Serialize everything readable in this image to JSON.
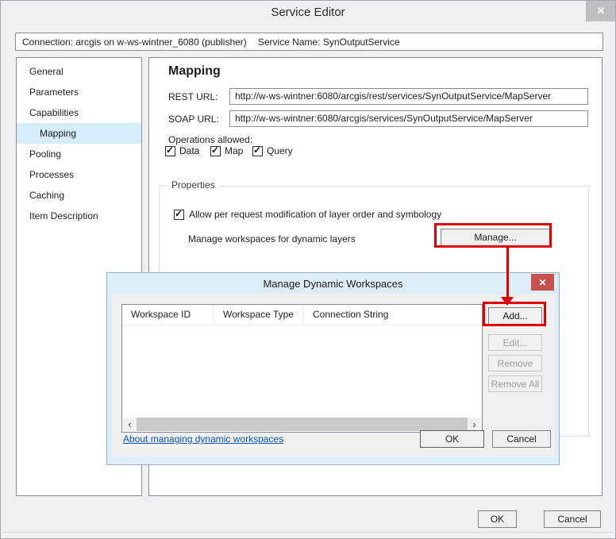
{
  "window": {
    "title": "Service Editor",
    "connection_text": "Connection: arcgis on w-ws-wintner_6080 (publisher)",
    "service_name_text": "Service Name: SynOutputService",
    "ok_label": "OK",
    "cancel_label": "Cancel"
  },
  "icons": {
    "close_x": "✕",
    "check": "✓",
    "scroll_left": "‹",
    "scroll_right": "›"
  },
  "sidebar": {
    "items": [
      {
        "label": "General",
        "selected": false
      },
      {
        "label": "Parameters",
        "selected": false
      },
      {
        "label": "Capabilities",
        "selected": false
      },
      {
        "label": "Mapping",
        "selected": true
      },
      {
        "label": "Pooling",
        "selected": false
      },
      {
        "label": "Processes",
        "selected": false
      },
      {
        "label": "Caching",
        "selected": false
      },
      {
        "label": "Item Description",
        "selected": false
      }
    ]
  },
  "main": {
    "heading": "Mapping",
    "rest_url": {
      "label": "REST URL:",
      "value": "http://w-ws-wintner:6080/arcgis/rest/services/SynOutputService/MapServer"
    },
    "soap_url": {
      "label": "SOAP URL:",
      "value": "http://w-ws-wintner:6080/arcgis/services/SynOutputService/MapServer"
    },
    "operations_label": "Operations allowed:",
    "operations": [
      {
        "label": "Data",
        "checked": true
      },
      {
        "label": "Map",
        "checked": true
      },
      {
        "label": "Query",
        "checked": true
      }
    ],
    "properties": {
      "legend": "Properties",
      "allow_checkbox_label": "Allow per request modification of layer order and symbology",
      "allow_checked": true,
      "manage_label": "Manage workspaces for dynamic layers",
      "manage_button": "Manage..."
    }
  },
  "dialog": {
    "title": "Manage Dynamic Workspaces",
    "table": {
      "columns": [
        "Workspace ID",
        "Workspace Type",
        "Connection String"
      ],
      "rows": []
    },
    "buttons": {
      "add": {
        "label": "Add...",
        "enabled": true,
        "highlighted": true
      },
      "edit": {
        "label": "Edit...",
        "enabled": false
      },
      "remove": {
        "label": "Remove",
        "enabled": false
      },
      "remove_all": {
        "label": "Remove All",
        "enabled": false
      }
    },
    "link": "About managing dynamic workspaces",
    "ok_label": "OK",
    "cancel_label": "Cancel"
  },
  "colors": {
    "annotation_red": "#e10000",
    "dialog_frame_blue": "#ddeef8",
    "dialog_close_red": "#c75050",
    "sidebar_selection_blue": "#d6eefb",
    "link_blue": "#0655b5",
    "window_bg": "#f0f0f0"
  }
}
